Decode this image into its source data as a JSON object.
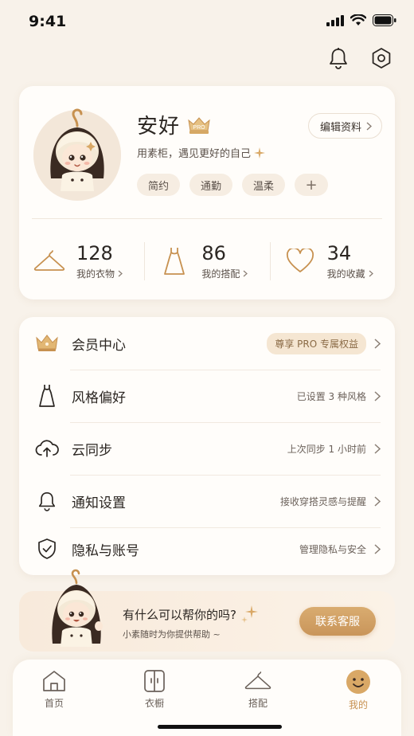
{
  "status": {
    "time": "9:41"
  },
  "profile": {
    "name": "安好",
    "badge": "PRO",
    "tagline": "用素柜，遇见更好的自己",
    "edit_label": "编辑资料",
    "tags": [
      "简约",
      "通勤",
      "温柔"
    ],
    "add_tag": "+"
  },
  "stats": [
    {
      "value": "128",
      "label": "我的衣物",
      "icon": "hanger-icon"
    },
    {
      "value": "86",
      "label": "我的搭配",
      "icon": "dress-icon"
    },
    {
      "value": "34",
      "label": "我的收藏",
      "icon": "heart-icon"
    }
  ],
  "menu": [
    {
      "label": "会员中心",
      "value": "尊享 PRO 专属权益",
      "icon": "crown-icon"
    },
    {
      "label": "风格偏好",
      "value": "已设置 3 种风格",
      "icon": "dress-icon"
    },
    {
      "label": "云同步",
      "value": "上次同步 1 小时前",
      "icon": "cloud-upload-icon"
    },
    {
      "label": "通知设置",
      "value": "接收穿搭灵感与提醒",
      "icon": "bell-icon"
    },
    {
      "label": "隐私与账号",
      "value": "管理隐私与安全",
      "icon": "shield-check-icon"
    }
  ],
  "help": {
    "title": "有什么可以帮你的吗?",
    "subtitle": "小素随时为你提供帮助 ~",
    "button": "联系客服"
  },
  "tabs": [
    {
      "label": "首页",
      "icon": "home-icon",
      "active": false
    },
    {
      "label": "衣橱",
      "icon": "wardrobe-icon",
      "active": false
    },
    {
      "label": "搭配",
      "icon": "hanger-icon",
      "active": false
    },
    {
      "label": "我的",
      "icon": "smile-icon",
      "active": true
    }
  ],
  "colors": {
    "accent": "#c79150",
    "background": "#f8f2ea",
    "card": "#fffdfa"
  }
}
